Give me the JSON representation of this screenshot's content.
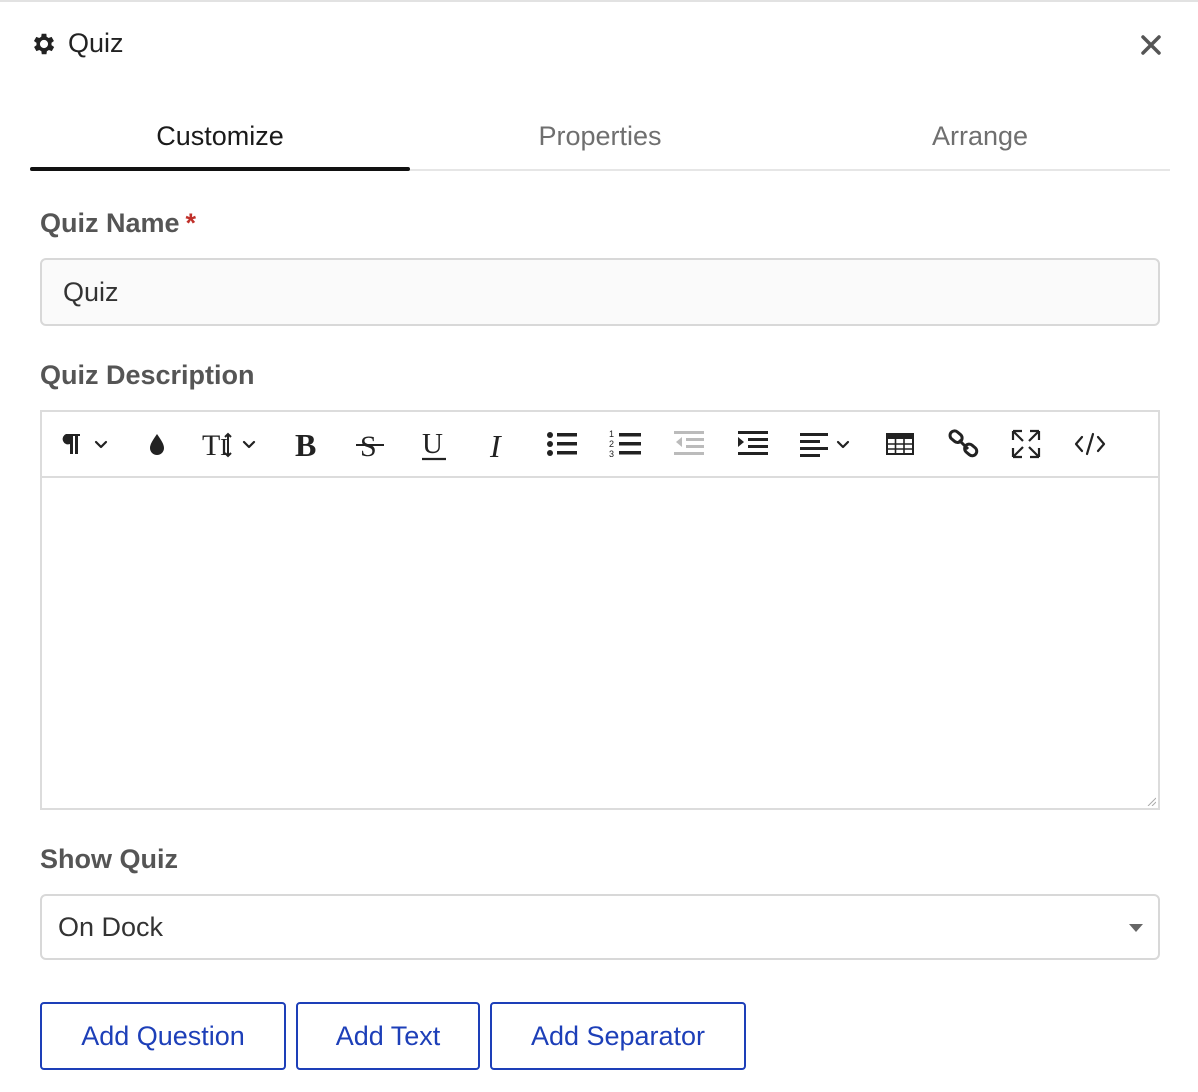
{
  "header": {
    "title": "Quiz",
    "icon": "gear-icon"
  },
  "tabs": [
    {
      "label": "Customize",
      "active": true
    },
    {
      "label": "Properties",
      "active": false
    },
    {
      "label": "Arrange",
      "active": false
    }
  ],
  "form": {
    "name_label": "Quiz Name",
    "required_marker": "*",
    "name_value": "Quiz",
    "description_label": "Quiz Description",
    "show_label": "Show Quiz",
    "show_value": "On Dock"
  },
  "toolbar": [
    "paragraph-format-icon",
    "text-color-icon",
    "font-size-icon",
    "bold-icon",
    "strikethrough-icon",
    "underline-icon",
    "italic-icon",
    "unordered-list-icon",
    "ordered-list-icon",
    "outdent-icon",
    "indent-icon",
    "align-icon",
    "insert-table-icon",
    "insert-link-icon",
    "fullscreen-icon",
    "code-view-icon"
  ],
  "buttons": {
    "add_question": "Add Question",
    "add_text": "Add Text",
    "add_separator": "Add Separator"
  },
  "colors": {
    "accent": "#1d3fb8",
    "required": "#c0302a",
    "active_tab_underline": "#111111"
  }
}
